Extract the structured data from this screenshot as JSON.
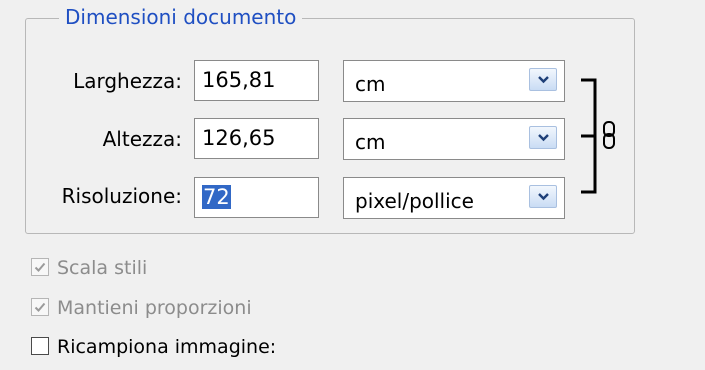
{
  "group": {
    "title": "Dimensioni documento"
  },
  "fields": [
    {
      "label": "Larghezza:",
      "value": "165,81",
      "unit": "cm"
    },
    {
      "label": "Altezza:",
      "value": "126,65",
      "unit": "cm"
    },
    {
      "label": "Risoluzione:",
      "value": "72",
      "unit": "pixel/pollice"
    }
  ],
  "link_icon": "chain-link-icon",
  "options": [
    {
      "label": "Scala stili",
      "checked": true,
      "enabled": false
    },
    {
      "label": "Mantieni proporzioni",
      "checked": true,
      "enabled": false
    },
    {
      "label": "Ricampiona immagine:",
      "checked": false,
      "enabled": true
    }
  ],
  "colors": {
    "group_title": "#1f4fc2",
    "selection": "#3168c6",
    "background": "#f0f0f0"
  }
}
